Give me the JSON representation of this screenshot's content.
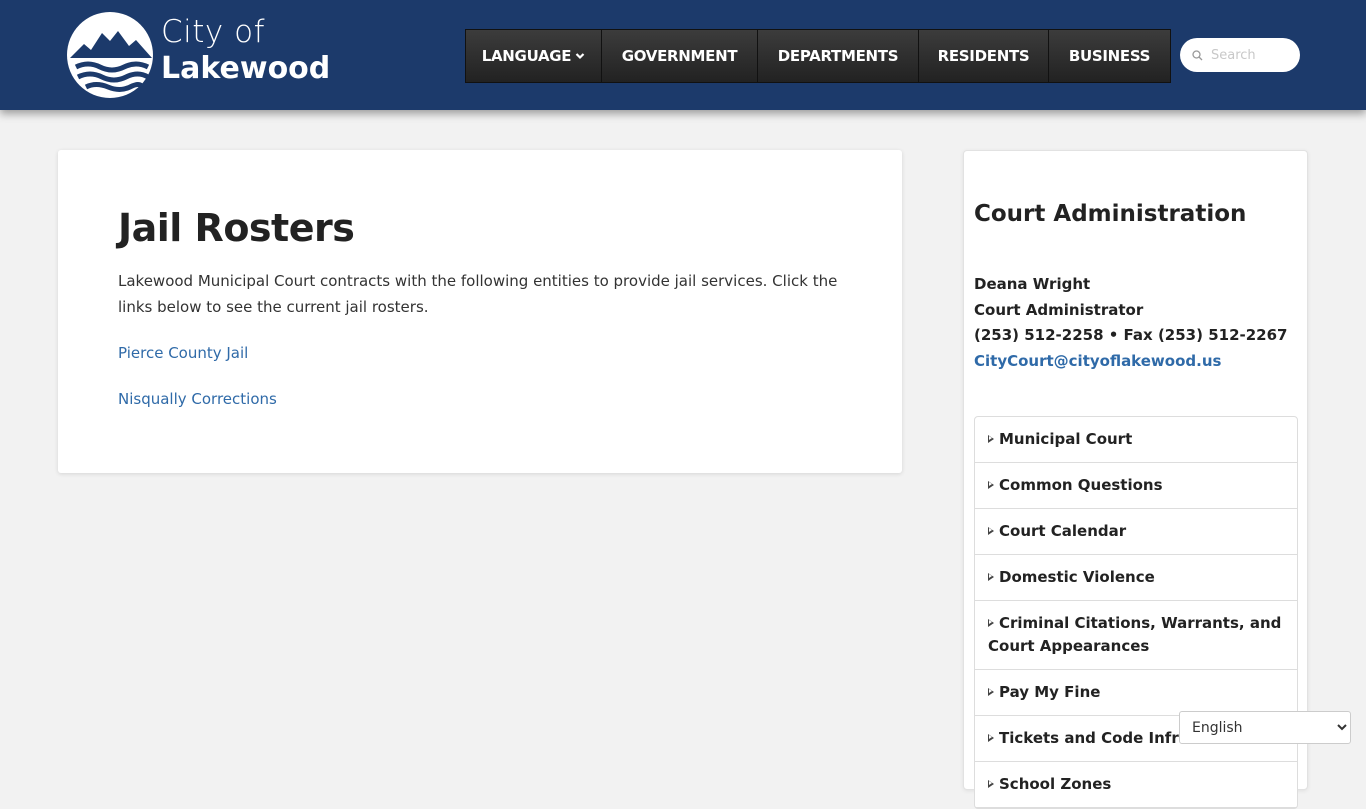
{
  "header": {
    "logo_line1": "City of",
    "logo_line2": "Lakewood",
    "nav": [
      {
        "label": "LANGUAGE",
        "has_dropdown": true
      },
      {
        "label": "GOVERNMENT"
      },
      {
        "label": "DEPARTMENTS"
      },
      {
        "label": "RESIDENTS"
      },
      {
        "label": "BUSINESS"
      }
    ],
    "search_placeholder": "Search"
  },
  "main": {
    "title": "Jail Rosters",
    "intro": "Lakewood Municipal Court contracts with the following entities to provide jail services. Click the links below to see the current jail rosters.",
    "links": [
      "Pierce County Jail",
      "Nisqually Corrections"
    ]
  },
  "sidebar": {
    "title": "Court Administration",
    "contact_name": "Deana Wright",
    "contact_role": "Court Administrator",
    "contact_phone": "(253) 512-2258 • Fax (253) 512-2267",
    "contact_email": "CityCourt@cityoflakewood.us",
    "menu": [
      "Municipal Court",
      "Common Questions",
      "Court Calendar",
      "Domestic Violence",
      "Criminal Citations, Warrants, and Court Appearances",
      "Pay My Fine",
      "Tickets and Code Infractions",
      "School Zones"
    ]
  },
  "language_select": {
    "selected": "English"
  },
  "colors": {
    "header_bg": "#1c3a6b",
    "link": "#2f6aa8",
    "page_bg": "#f2f2f2"
  }
}
